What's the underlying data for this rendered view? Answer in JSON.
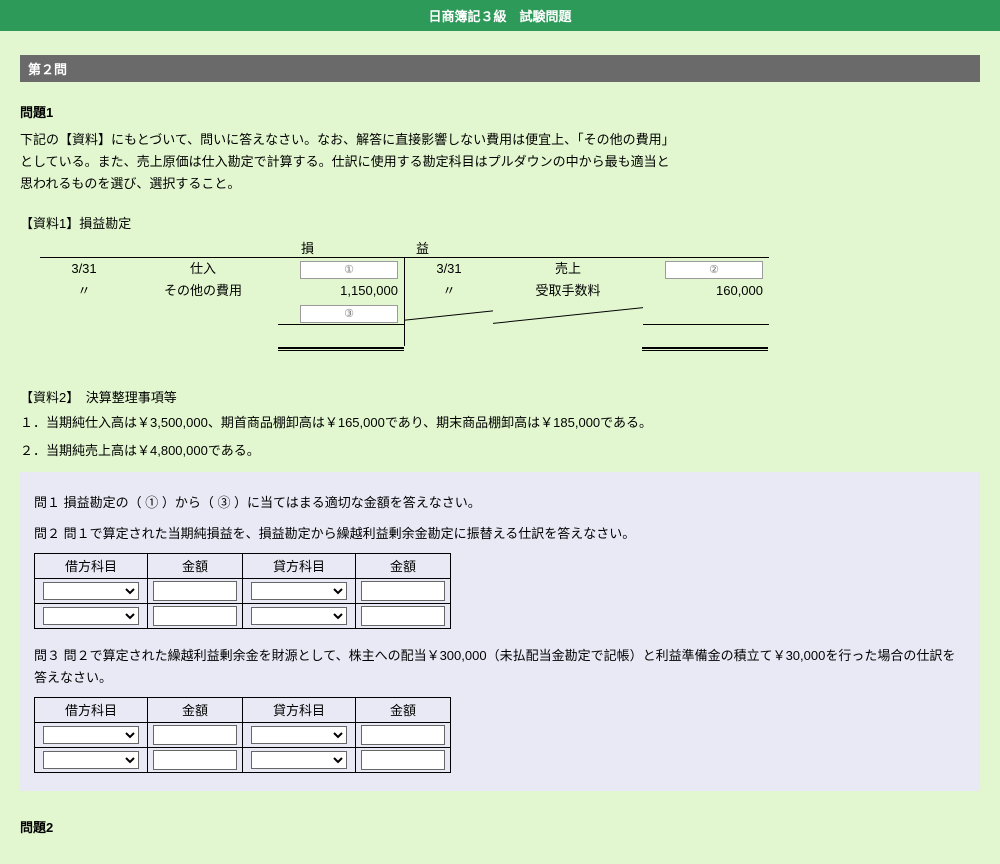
{
  "header": {
    "title": "日商簿記３級　試験問題"
  },
  "section": {
    "label": "第２問"
  },
  "mondai1": {
    "title": "問題1",
    "text": "下記の【資料】にもとづいて、問いに答えなさい。なお、解答に直接影響しない費用は便宜上、「その他の費用」としている。また、売上原価は仕入勘定で計算する。仕訳に使用する勘定科目はプルダウンの中から最も適当と思われるものを選び、選択すること。",
    "res1_title": "【資料1】損益勘定",
    "t_caption": {
      "left": "損",
      "right": "益"
    },
    "t_rows_left": [
      {
        "date": "3/31",
        "item": "仕入",
        "amount_box": "①"
      },
      {
        "date": "〃",
        "item": "その他の費用",
        "amount_text": "1,150,000"
      },
      {
        "date": "",
        "item": "",
        "amount_box": "③"
      }
    ],
    "t_rows_right": [
      {
        "date": "3/31",
        "item": "売上",
        "amount_box": "②"
      },
      {
        "date": "〃",
        "item": "受取手数料",
        "amount_text": "160,000"
      }
    ],
    "res2_title": "【資料2】　決算整理事項等",
    "res2_lines": [
      "１．当期純仕入高は￥3,500,000、期首商品棚卸高は￥165,000であり、期末商品棚卸高は￥185,000である。",
      "２．当期純売上高は￥4,800,000である。"
    ]
  },
  "answers": {
    "q1": "問１ 損益勘定の（ ① ）から（ ③ ）に当てはまる適切な金額を答えなさい。",
    "q2": "問２ 問１で算定された当期純損益を、損益勘定から繰越利益剰余金勘定に振替える仕訳を答えなさい。",
    "q3": "問３ 問２で算定された繰越利益剰余金を財源として、株主への配当￥300,000（未払配当金勘定で記帳）と利益準備金の積立て￥30,000を行った場合の仕訳を答えなさい。",
    "table_headers": {
      "dr_acc": "借方科目",
      "dr_amt": "金額",
      "cr_acc": "貸方科目",
      "cr_amt": "金額"
    }
  },
  "mondai2": {
    "title": "問題2"
  }
}
